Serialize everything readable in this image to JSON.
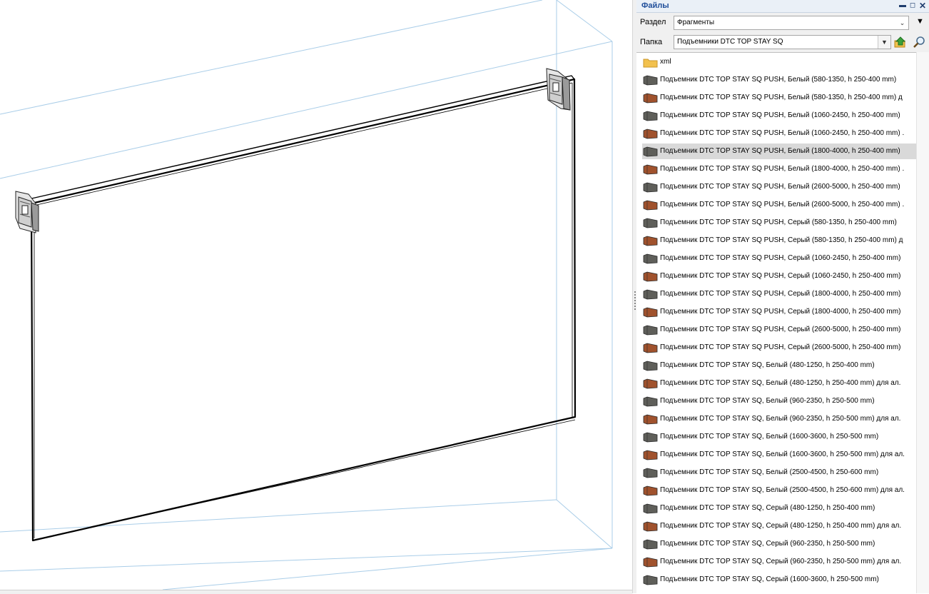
{
  "panel": {
    "title": "Файлы",
    "section_label": "Раздел",
    "section_value": "Фрагменты",
    "folder_label": "Папка",
    "folder_value": "Подъемники DTC TOP STAY SQ",
    "header_buttons": [
      "minimize-icon",
      "restore-icon",
      "close-icon"
    ],
    "toolbar_icons": [
      "folder-up-icon",
      "search-icon"
    ]
  },
  "files": [
    {
      "label": "xml",
      "icon": "folder",
      "selected": false
    },
    {
      "label": "Подъемник DTC TOP STAY SQ PUSH, Белый (580-1350, h 250-400 mm)",
      "icon": "gray",
      "selected": false
    },
    {
      "label": "Подъемник DTC TOP STAY SQ PUSH, Белый (580-1350, h 250-400 mm) д",
      "icon": "brown",
      "selected": false
    },
    {
      "label": "Подъемник DTC TOP STAY SQ PUSH, Белый (1060-2450, h 250-400 mm)",
      "icon": "gray",
      "selected": false
    },
    {
      "label": "Подъемник DTC TOP STAY SQ PUSH, Белый (1060-2450, h 250-400 mm) .",
      "icon": "brown",
      "selected": false
    },
    {
      "label": "Подъемник DTC TOP STAY SQ PUSH, Белый (1800-4000, h 250-400 mm)",
      "icon": "gray",
      "selected": true
    },
    {
      "label": "Подъемник DTC TOP STAY SQ PUSH, Белый (1800-4000, h 250-400 mm) .",
      "icon": "brown",
      "selected": false
    },
    {
      "label": "Подъемник DTC TOP STAY SQ PUSH, Белый (2600-5000, h 250-400 mm)",
      "icon": "gray",
      "selected": false
    },
    {
      "label": "Подъемник DTC TOP STAY SQ PUSH, Белый (2600-5000, h 250-400 mm) .",
      "icon": "brown",
      "selected": false
    },
    {
      "label": "Подъемник DTC TOP STAY SQ PUSH, Серый (580-1350, h 250-400 mm)",
      "icon": "gray",
      "selected": false
    },
    {
      "label": "Подъемник DTC TOP STAY SQ PUSH, Серый (580-1350, h 250-400 mm) д",
      "icon": "brown",
      "selected": false
    },
    {
      "label": "Подъемник DTC TOP STAY SQ PUSH, Серый (1060-2450, h 250-400 mm)",
      "icon": "gray",
      "selected": false
    },
    {
      "label": "Подъемник DTC TOP STAY SQ PUSH, Серый (1060-2450, h 250-400 mm)",
      "icon": "brown",
      "selected": false
    },
    {
      "label": "Подъемник DTC TOP STAY SQ PUSH, Серый (1800-4000, h 250-400 mm)",
      "icon": "gray",
      "selected": false
    },
    {
      "label": "Подъемник DTC TOP STAY SQ PUSH, Серый (1800-4000, h 250-400 mm)",
      "icon": "brown",
      "selected": false
    },
    {
      "label": "Подъемник DTC TOP STAY SQ PUSH, Серый (2600-5000, h 250-400 mm)",
      "icon": "gray",
      "selected": false
    },
    {
      "label": "Подъемник DTC TOP STAY SQ PUSH, Серый (2600-5000, h 250-400 mm)",
      "icon": "brown",
      "selected": false
    },
    {
      "label": "Подъемник DTC TOP STAY SQ, Белый (480-1250, h 250-400 mm)",
      "icon": "gray",
      "selected": false
    },
    {
      "label": "Подъемник DTC TOP STAY SQ, Белый (480-1250, h 250-400 mm) для ал.",
      "icon": "brown",
      "selected": false
    },
    {
      "label": "Подъемник DTC TOP STAY SQ, Белый (960-2350, h 250-500 mm)",
      "icon": "gray",
      "selected": false
    },
    {
      "label": "Подъемник DTC TOP STAY SQ, Белый (960-2350, h 250-500 mm) для ал.",
      "icon": "brown",
      "selected": false
    },
    {
      "label": "Подъемник DTC TOP STAY SQ, Белый (1600-3600, h 250-500 mm)",
      "icon": "gray",
      "selected": false
    },
    {
      "label": "Подъемник DTC TOP STAY SQ, Белый (1600-3600, h 250-500 mm) для ал.",
      "icon": "brown",
      "selected": false
    },
    {
      "label": "Подъемник DTC TOP STAY SQ, Белый (2500-4500, h 250-600 mm)",
      "icon": "gray",
      "selected": false
    },
    {
      "label": "Подъемник DTC TOP STAY SQ, Белый (2500-4500, h 250-600 mm) для ал.",
      "icon": "brown",
      "selected": false
    },
    {
      "label": "Подъемник DTC TOP STAY SQ, Серый (480-1250, h 250-400 mm)",
      "icon": "gray",
      "selected": false
    },
    {
      "label": "Подъемник DTC TOP STAY SQ, Серый (480-1250, h 250-400 mm) для ал.",
      "icon": "brown",
      "selected": false
    },
    {
      "label": "Подъемник DTC TOP STAY SQ, Серый (960-2350, h 250-500 mm)",
      "icon": "gray",
      "selected": false
    },
    {
      "label": "Подъемник DTC TOP STAY SQ, Серый (960-2350, h 250-500 mm) для ал.",
      "icon": "brown",
      "selected": false
    },
    {
      "label": "Подъемник DTC TOP STAY SQ, Серый (1600-3600, h 250-500 mm)",
      "icon": "gray",
      "selected": false
    }
  ],
  "colors": {
    "panel_title": "#1f4e9a",
    "guide_lines": "#a9cde8",
    "selection": "#d9d9d9",
    "icon_gray": "#5f5f5a",
    "icon_brown": "#a0522d",
    "folder": "#f2c14e"
  }
}
